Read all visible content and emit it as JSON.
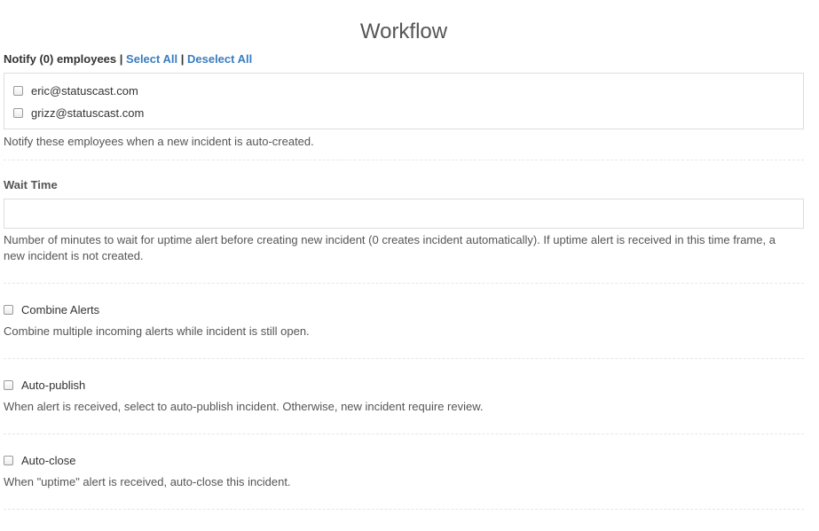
{
  "title": "Workflow",
  "notify": {
    "label": "Notify (0) employees",
    "separator": "|",
    "select_all": "Select All",
    "deselect_all": "Deselect All",
    "employees": [
      {
        "email": "eric@statuscast.com",
        "checked": false
      },
      {
        "email": "grizz@statuscast.com",
        "checked": false
      }
    ],
    "help": "Notify these employees when a new incident is auto-created."
  },
  "wait_time": {
    "label": "Wait Time",
    "value": "",
    "placeholder": "",
    "help_line1": "Number of minutes to wait for uptime alert before creating new incident (0 creates incident automatically). If uptime alert is received in this time frame, a",
    "help_line2": "new incident is not created."
  },
  "combine_alerts": {
    "label": "Combine Alerts",
    "checked": false,
    "help": "Combine multiple incoming alerts while incident is still open."
  },
  "auto_publish": {
    "label": "Auto-publish",
    "checked": false,
    "help": "When alert is received, select to auto-publish incident. Otherwise, new incident require review."
  },
  "auto_close": {
    "label": "Auto-close",
    "checked": false,
    "help": "When \"uptime\" alert is received, auto-close this incident."
  }
}
